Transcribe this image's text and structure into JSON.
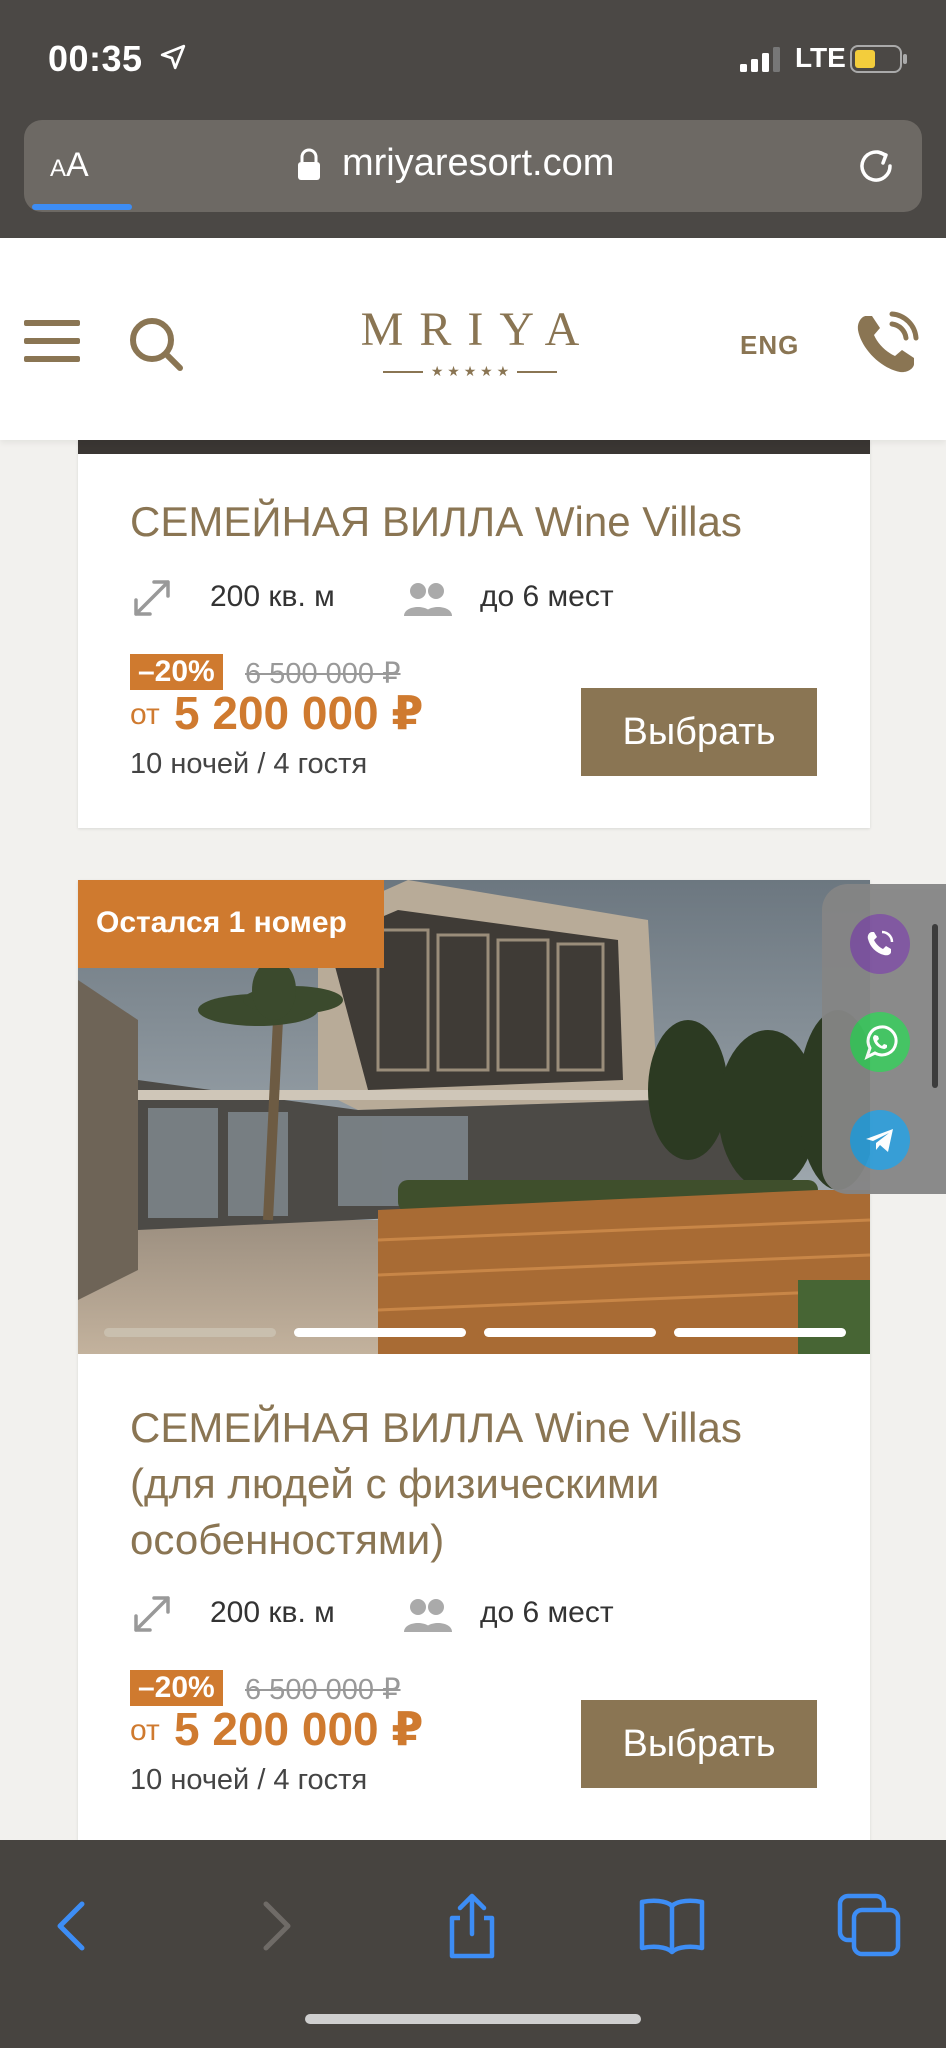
{
  "status": {
    "time": "00:35",
    "network": "LTE"
  },
  "browser": {
    "text_size_label": "AA",
    "url": "mriyaresort.com"
  },
  "header": {
    "logo": "MRIYA",
    "stars": "★ ★ ★ ★ ★",
    "lang": "ENG"
  },
  "cards": [
    {
      "title": "СЕМЕЙНАЯ ВИЛЛА Wine Villas",
      "area": "200 кв. м",
      "guests": "до 6 мест",
      "discount": "–20%",
      "old_price": "6 500 000 ₽",
      "from": "от",
      "price": "5 200 000 ₽",
      "nights": "10 ночей / 4 гостя",
      "button": "Выбрать"
    },
    {
      "badge": "Остался 1 номер",
      "title": "СЕМЕЙНАЯ ВИЛЛА Wine Villas (для людей с физическими особенностями)",
      "area": "200 кв. м",
      "guests": "до 6 мест",
      "discount": "–20%",
      "old_price": "6 500 000 ₽",
      "from": "от",
      "price": "5 200 000 ₽",
      "nights": "10 ночей / 4 гостя",
      "button": "Выбрать",
      "carousel_slides": 4,
      "carousel_active": 1
    }
  ],
  "messengers": [
    "viber-icon",
    "whatsapp-icon",
    "telegram-icon"
  ],
  "colors": {
    "brand": "#8a7553",
    "accent": "#cf7a2f",
    "ios_blue": "#3d8df5"
  }
}
